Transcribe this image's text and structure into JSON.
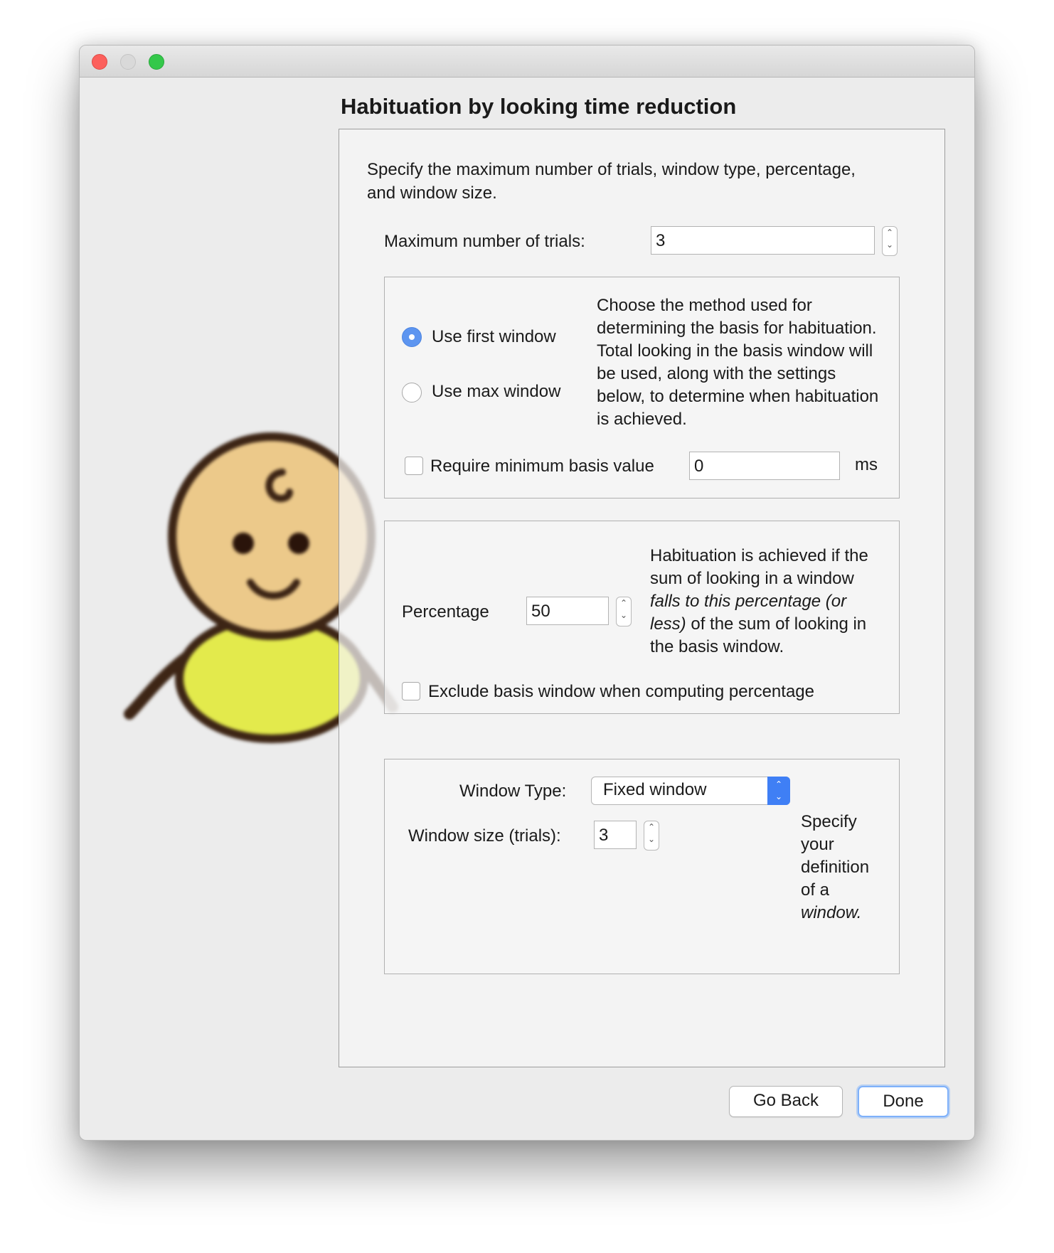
{
  "window": {
    "traffic_lights": [
      "close",
      "minimize",
      "zoom"
    ]
  },
  "dialog": {
    "title": "Habituation by looking time reduction",
    "intro": "Specify the maximum number of trials, window type, percentage, and window size."
  },
  "max_trials": {
    "label": "Maximum number of trials:",
    "value": "3"
  },
  "basis": {
    "options": [
      {
        "label": "Use first window",
        "checked": true
      },
      {
        "label": "Use max window",
        "checked": false
      }
    ],
    "description": "Choose the method used for determining the basis for habituation. Total looking in the basis window will be used, along with the settings below, to determine when habituation is achieved.",
    "min_basis": {
      "label": "Require minimum basis value",
      "checked": false,
      "value": "0",
      "unit": "ms"
    }
  },
  "percentage": {
    "label": "Percentage",
    "value": "50",
    "desc_part1": "Habituation is achieved if the sum of looking in a window ",
    "desc_italic": "falls to this percentage (or less)",
    "desc_part2": " of the sum of looking in the basis window.",
    "exclude": {
      "label": "Exclude basis window when computing percentage",
      "checked": false
    }
  },
  "window_settings": {
    "type_label": "Window Type:",
    "type_value": "Fixed window",
    "size_label": "Window size (trials):",
    "size_value": "3",
    "desc_part1": "Specify your definition of a ",
    "desc_italic": "window."
  },
  "buttons": {
    "back": "Go Back",
    "done": "Done"
  },
  "colors": {
    "accent": "#3f7ff5",
    "close": "#fc605c",
    "zoom": "#34c84a",
    "baby_skin": "#ecc98a",
    "baby_shirt": "#e3ea4c",
    "outline": "#3d2515"
  },
  "illustration": {
    "icon": "baby-icon"
  }
}
